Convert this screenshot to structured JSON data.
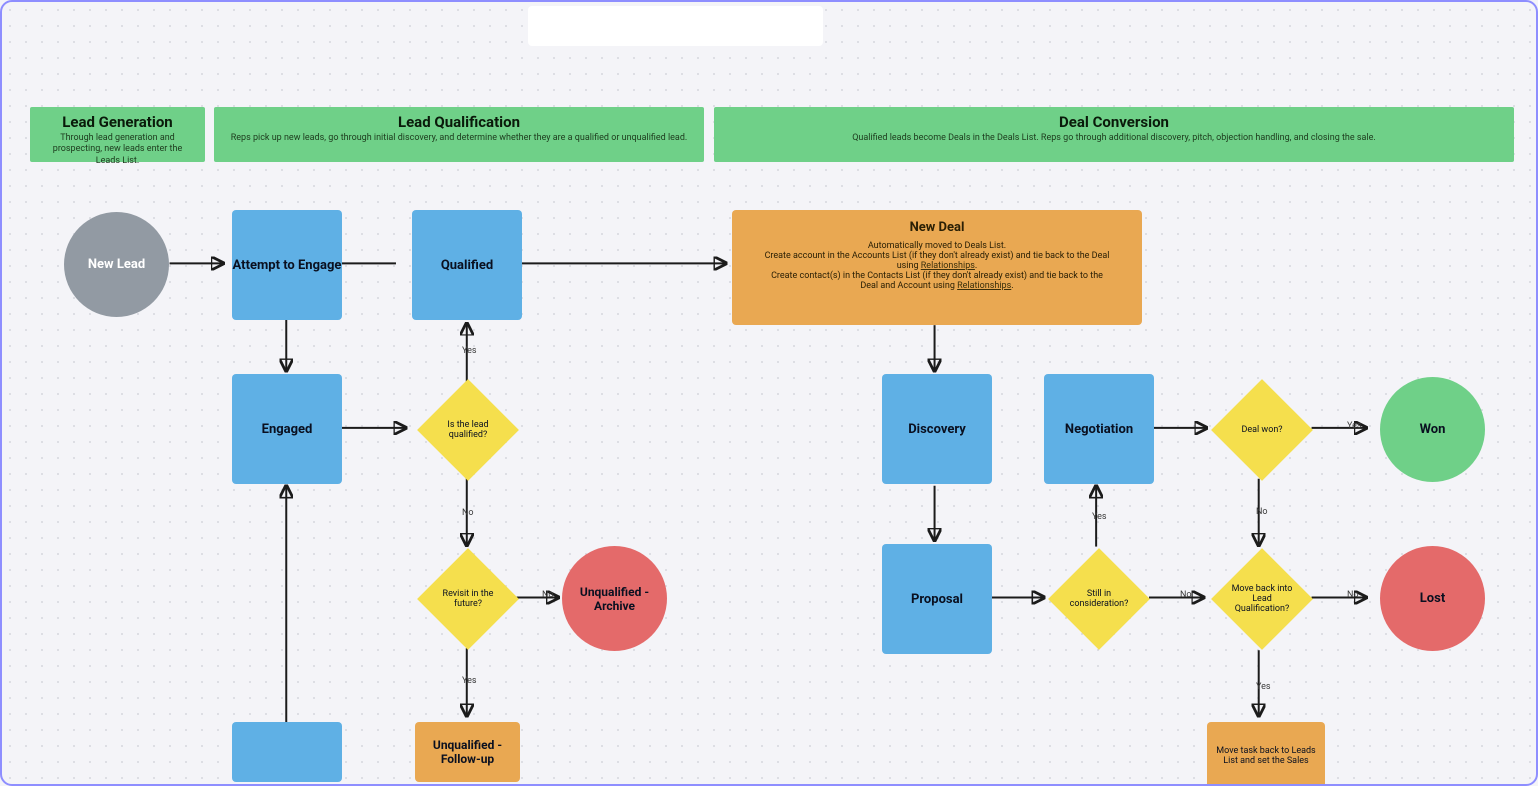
{
  "stages": {
    "lead_gen": {
      "title": "Lead Generation",
      "sub": "Through lead generation and prospecting, new leads enter the Leads List."
    },
    "lead_qual": {
      "title": "Lead Qualification",
      "sub": "Reps pick up new leads, go through initial discovery, and determine whether they are a qualified or unqualified lead."
    },
    "deal_conv": {
      "title": "Deal Conversion",
      "sub": "Qualified leads become Deals in the Deals List. Reps go through additional discovery, pitch, objection handling, and closing the sale."
    }
  },
  "nodes": {
    "new_lead": "New Lead",
    "attempt": "Attempt to Engage",
    "qualified": "Qualified",
    "engaged": "Engaged",
    "q_lead_qualified": "Is the lead qualified?",
    "q_revisit": "Revisit in the future?",
    "unq_archive": "Unqualified - Archive",
    "unq_follow": "Unqualified - Follow-up",
    "discovery": "Discovery",
    "negotiation": "Negotiation",
    "q_deal_won": "Deal won?",
    "won": "Won",
    "proposal": "Proposal",
    "q_still": "Still in consideration?",
    "q_move_back": "Move back into Lead Qualification?",
    "lost": "Lost",
    "move_task": "Move task back to Leads List and set the Sales"
  },
  "new_deal": {
    "title": "New Deal",
    "l1": "Automatically moved to Deals List.",
    "l2a": "Create account in the Accounts List (if they don't already exist) and tie back to the Deal using ",
    "l2b": "Relationships",
    "l2c": ".",
    "l3a": "Create contact(s) in the Contacts List (if they don't already exist) and tie back to the Deal and Account using ",
    "l3b": "Relationships",
    "l3c": "."
  },
  "labels": {
    "yes": "Yes",
    "no": "No"
  }
}
